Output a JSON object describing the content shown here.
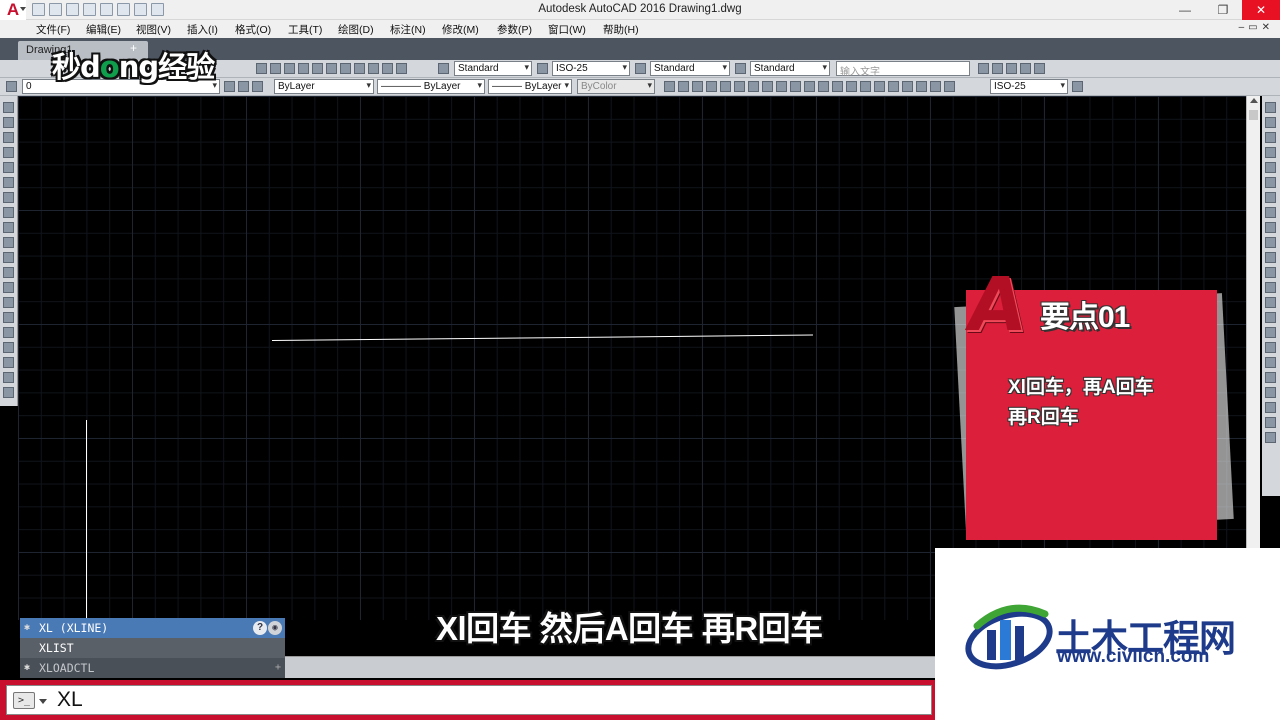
{
  "window": {
    "title": "Autodesk AutoCAD 2016    Drawing1.dwg",
    "app_logo": "A",
    "controls": [
      "—",
      "❐",
      "✕"
    ]
  },
  "menu": {
    "items": [
      "文件(F)",
      "编辑(E)",
      "视图(V)",
      "插入(I)",
      "格式(O)",
      "工具(T)",
      "绘图(D)",
      "标注(N)",
      "修改(M)",
      "参数(P)",
      "窗口(W)",
      "帮助(H)"
    ],
    "mdi_controls": "–▭✕"
  },
  "tabs": {
    "file_tab": "Drawing1",
    "add": "+"
  },
  "toolbar1": {
    "text_style": "Standard",
    "dim_style": "ISO-25",
    "table_style": "Standard",
    "mleader_style": "Standard",
    "search_placeholder": "输入文字"
  },
  "toolbar2": {
    "layer": "0",
    "color": "ByLayer",
    "linetype": "———— ByLayer",
    "lineweight": "——— ByLayer",
    "plotstyle": "ByColor",
    "dim_style": "ISO-25"
  },
  "autocomplete": {
    "items": [
      {
        "label": "XL (XLINE)"
      },
      {
        "label": "XLIST"
      },
      {
        "label": "XLOADCTL"
      }
    ],
    "help_icon": "?"
  },
  "command": {
    "prompt_icon": ">_",
    "text": "XL"
  },
  "overlay": {
    "watermark_a": "秒d",
    "watermark_o": "o",
    "watermark_b": "ng经验",
    "card_logo": "A",
    "card_title": "要点01",
    "card_line1": "Xl回车，再A回车",
    "card_line2": "再R回车",
    "subtitle": "Xl回车 然后A回车 再R回车",
    "brand_name": "土木工程网",
    "brand_url": "www.civilcn.com"
  },
  "colors": {
    "accent_red": "#dc1f3a",
    "autocad_red": "#c8102e",
    "brand_blue": "#1e3a8a",
    "brand_green": "#3fa535"
  }
}
